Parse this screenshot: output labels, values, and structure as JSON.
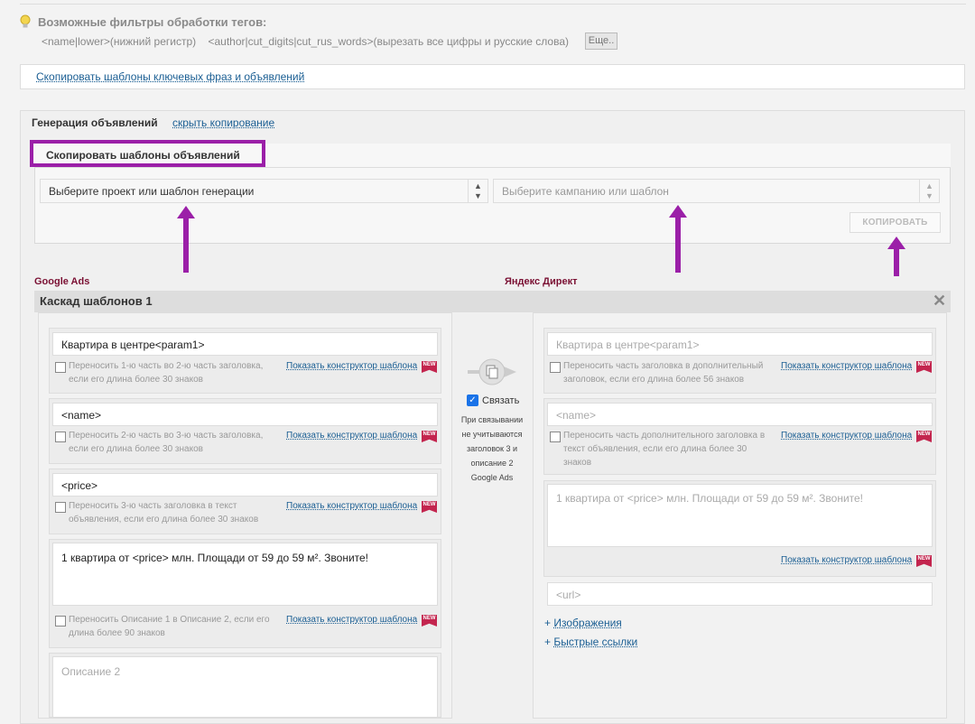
{
  "filters": {
    "title": "Возможные фильтры обработки тегов:",
    "item1": "<name|lower>(нижний регистр)",
    "item2": "<author|cut_digits|cut_rus_words>(вырезать все цифры и русские слова)",
    "more": "Еще.."
  },
  "copy_keyphrases_link": "Скопировать шаблоны ключевых фраз и объявлений",
  "section": {
    "title": "Генерация объявлений",
    "hide_link": "скрыть копирование"
  },
  "copy": {
    "title": "Скопировать шаблоны объявлений",
    "project_select": "Выберите проект или шаблон генерации",
    "campaign_select": "Выберите кампанию или шаблон",
    "button": "КОПИРОВАТЬ"
  },
  "google_label": "Google Ads",
  "yandex_label": "Яндекс Директ",
  "cascade_title": "Каскад шаблонов 1",
  "constructor_label": "Показать конструктор шаблона",
  "new_badge": "NEW",
  "google": {
    "headline1": "Квартира в центре<param1>",
    "note1a": "Переносить 1-ю часть во 2-ю часть заголовка,",
    "note1b": "если его длина более 30 знаков",
    "headline2": "<name>",
    "note2a": "Переносить 2-ю часть во 3-ю часть заголовка,",
    "note2b": "если его длина более 30 знаков",
    "headline3": "<price>",
    "note3a": "Переносить 3-ю часть заголовка в текст",
    "note3b": "объявления, если его длина более 30 знаков",
    "description1": "1 квартира от <price> млн. Площади от 59 до 59 м². Звоните!",
    "note4a": "Переносить Описание 1 в Описание 2, если его",
    "note4b": "длина более 90 знаков",
    "description2_placeholder": "Описание 2"
  },
  "link_block": {
    "checkbox_label": "Связать",
    "line1": "При связывании",
    "line2": "не учитываются",
    "line3": "заголовок 3 и",
    "line4": "описание 2",
    "line5": "Google Ads"
  },
  "yandex": {
    "headline": "Квартира в центре<param1>",
    "note1a": "Переносить часть заголовка в дополнительный",
    "note1b": "заголовок, если его длина более 56 знаков",
    "extra_headline": "<name>",
    "note2a": "Переносить часть дополнительного заголовка в",
    "note2b": "текст объявления, если его длина более 30",
    "note2c": "знаков",
    "text": "1 квартира от <price> млн. Площади от 59 до 59 м². Звоните!",
    "url": "<url>",
    "images_link": "Изображения",
    "quicklinks_link": "Быстрые ссылки"
  },
  "colors": {
    "accent_purple": "#9b1fa8",
    "link": "#1a5e93",
    "new_badge": "#c3254e",
    "label_red": "#7a1033"
  }
}
